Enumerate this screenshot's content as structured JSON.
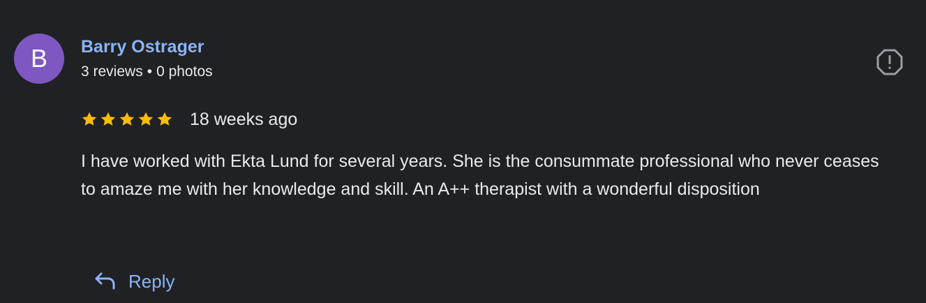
{
  "reviewer": {
    "initial": "B",
    "avatar_color": "#7e57c2",
    "name": "Barry Ostrager",
    "reviews": "3 reviews",
    "separator": "•",
    "photos": "0 photos"
  },
  "rating": {
    "stars": 5,
    "max_stars": 5,
    "star_color": "#fbbc04",
    "time": "18 weeks ago"
  },
  "review": {
    "text": "I have worked with Ekta Lund for several years. She is the consummate professional who never ceases to amaze me with her knowledge and skill. An A++ therapist with a wonderful disposition"
  },
  "actions": {
    "reply_label": "Reply",
    "reply_icon": "reply-arrow-icon",
    "report_icon": "report-icon"
  },
  "theme": {
    "background": "#202124",
    "text": "#e8eaed",
    "link": "#8ab4f8"
  }
}
